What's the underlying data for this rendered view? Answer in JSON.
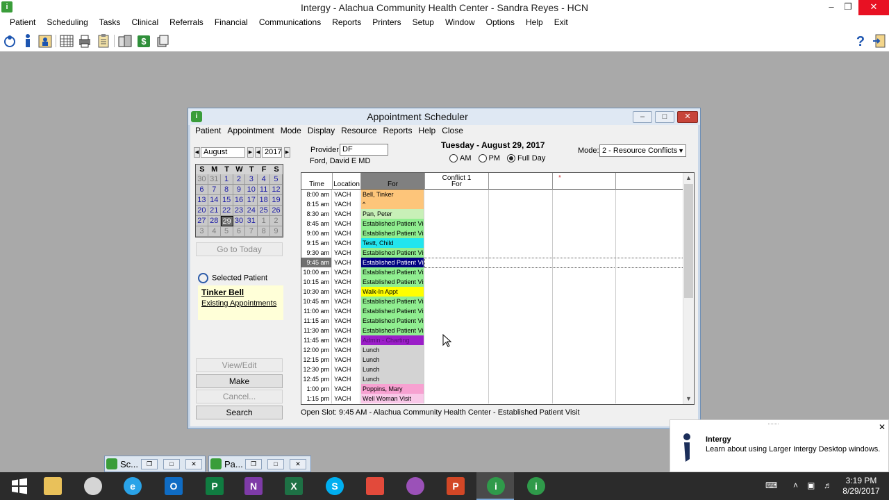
{
  "app": {
    "title": "Intergy - Alachua Community Health Center - Sandra Reyes - HCN",
    "menu": [
      "Patient",
      "Scheduling",
      "Tasks",
      "Clinical",
      "Referrals",
      "Financial",
      "Communications",
      "Reports",
      "Printers",
      "Setup",
      "Window",
      "Options",
      "Help",
      "Exit"
    ]
  },
  "scheduler": {
    "title": "Appointment Scheduler",
    "menu": [
      "Patient",
      "Appointment",
      "Mode",
      "Display",
      "Resource",
      "Reports",
      "Help",
      "Close"
    ],
    "month": "August",
    "year": "2017",
    "weekdays": [
      "S",
      "M",
      "T",
      "W",
      "T",
      "F",
      "S"
    ],
    "calendar_weeks": [
      [
        "30",
        "31",
        "1",
        "2",
        "3",
        "4",
        "5"
      ],
      [
        "6",
        "7",
        "8",
        "9",
        "10",
        "11",
        "12"
      ],
      [
        "13",
        "14",
        "15",
        "16",
        "17",
        "18",
        "19"
      ],
      [
        "20",
        "21",
        "22",
        "23",
        "24",
        "25",
        "26"
      ],
      [
        "27",
        "28",
        "29",
        "30",
        "31",
        "1",
        "2"
      ],
      [
        "3",
        "4",
        "5",
        "6",
        "7",
        "8",
        "9"
      ]
    ],
    "selected_day": "29",
    "go_today": "Go to Today",
    "selected_patient_label": "Selected Patient",
    "selected_patient_name": "Tinker Bell",
    "existing_appointments": "Existing Appointments",
    "buttons": {
      "view_edit": "View/Edit",
      "make": "Make",
      "cancel": "Cancel...",
      "search": "Search"
    },
    "provider_label": "Provider:",
    "provider_code": "DF",
    "provider_name": "Ford, David E MD",
    "date": "Tuesday - August  29, 2017",
    "radios": {
      "am": "AM",
      "pm": "PM",
      "full": "Full Day"
    },
    "mode_label": "Mode:",
    "mode_value": "2 - Resource Conflicts",
    "columns": {
      "time": "Time",
      "location": "Location",
      "for": "For",
      "conflict1": "Conflict 1",
      "conflict1_for": "For",
      "col5": "*"
    },
    "rows": [
      {
        "time": "8:00 am",
        "loc": "YACH",
        "for": "Bell, Tinker",
        "color": "#fdc57a"
      },
      {
        "time": "8:15 am",
        "loc": "YACH",
        "for": "^",
        "color": "#fdc57a"
      },
      {
        "time": "8:30 am",
        "loc": "YACH",
        "for": "Pan, Peter",
        "color": "#c8f0b8"
      },
      {
        "time": "8:45 am",
        "loc": "YACH",
        "for": "Established Patient Vis",
        "color": "#90ee90"
      },
      {
        "time": "9:00 am",
        "loc": "YACH",
        "for": "Established Patient Vis",
        "color": "#90ee90"
      },
      {
        "time": "9:15 am",
        "loc": "YACH",
        "for": "Testt, Child",
        "color": "#22e5ee"
      },
      {
        "time": "9:30 am",
        "loc": "YACH",
        "for": "Established Patient Vis",
        "color": "#90ee90"
      },
      {
        "time": "9:45 am",
        "loc": "YACH",
        "for": "Established Patient Vis",
        "color": "#000080"
      },
      {
        "time": "10:00 am",
        "loc": "YACH",
        "for": "Established Patient Vis",
        "color": "#90ee90"
      },
      {
        "time": "10:15 am",
        "loc": "YACH",
        "for": "Established Patient Vis",
        "color": "#90ee90"
      },
      {
        "time": "10:30 am",
        "loc": "YACH",
        "for": "Walk-In Appt",
        "color": "#ffff00"
      },
      {
        "time": "10:45 am",
        "loc": "YACH",
        "for": "Established Patient Vis",
        "color": "#90ee90"
      },
      {
        "time": "11:00 am",
        "loc": "YACH",
        "for": "Established Patient Vis",
        "color": "#90ee90"
      },
      {
        "time": "11:15 am",
        "loc": "YACH",
        "for": "Established Patient Vis",
        "color": "#90ee90"
      },
      {
        "time": "11:30 am",
        "loc": "YACH",
        "for": "Established Patient Vis",
        "color": "#90ee90"
      },
      {
        "time": "11:45 am",
        "loc": "YACH",
        "for": "Admin - Charting",
        "color": "#9b1ec8"
      },
      {
        "time": "12:00 pm",
        "loc": "YACH",
        "for": "Lunch",
        "color": "#d3d3d3"
      },
      {
        "time": "12:15 pm",
        "loc": "YACH",
        "for": "Lunch",
        "color": "#d3d3d3"
      },
      {
        "time": "12:30 pm",
        "loc": "YACH",
        "for": "Lunch",
        "color": "#d3d3d3"
      },
      {
        "time": "12:45 pm",
        "loc": "YACH",
        "for": "Lunch",
        "color": "#d3d3d3"
      },
      {
        "time": "1:00 pm",
        "loc": "YACH",
        "for": "Poppins, Mary",
        "color": "#f7a1d1"
      },
      {
        "time": "1:15 pm",
        "loc": "YACH",
        "for": "Well Woman Visit",
        "color": "#f9c8e8"
      }
    ],
    "status": "Open Slot: 9:45 AM - Alachua Community Health Center - Established Patient Visit"
  },
  "minimized": [
    {
      "label": "Sc..."
    },
    {
      "label": "Pa..."
    }
  ],
  "toast": {
    "title": "Intergy",
    "message": "Learn about using Larger Intergy Desktop windows."
  },
  "clock": {
    "time": "3:19 PM",
    "date": "8/29/2017"
  }
}
